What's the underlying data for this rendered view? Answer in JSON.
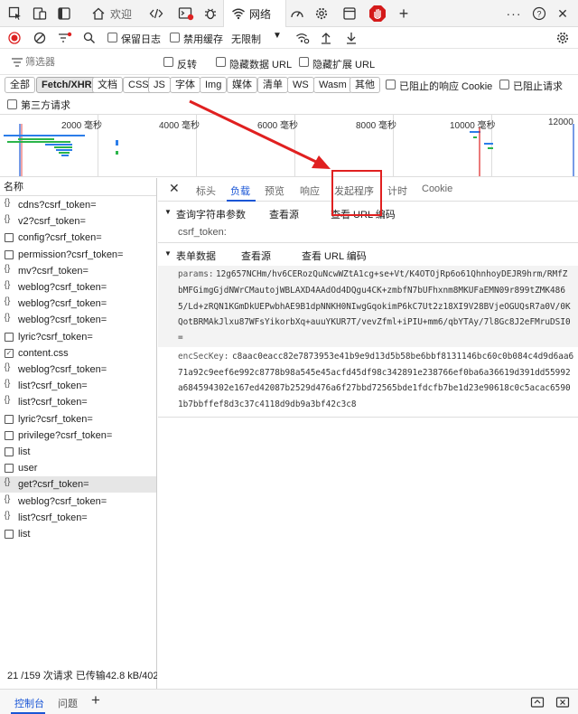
{
  "tabs": {
    "welcome": "欢迎",
    "network": "网络"
  },
  "toolbar": {
    "preserve_log": "保留日志",
    "disable_cache": "禁用缓存",
    "throttle": "无限制"
  },
  "filter": {
    "placeholder": "筛选器",
    "invert": "反转",
    "hide_data_url": "隐藏数据 URL",
    "hide_ext_url": "隐藏扩展 URL"
  },
  "types": [
    "全部",
    "Fetch/XHR",
    "文档",
    "CSS",
    "JS",
    "字体",
    "Img",
    "媒体",
    "清单",
    "WS",
    "Wasm",
    "其他"
  ],
  "blocked_cookie": "已阻止的响应 Cookie",
  "blocked_requests": "已阻止请求",
  "third_party": "第三方请求",
  "timeline_ticks": [
    "2000 毫秒",
    "4000 毫秒",
    "6000 毫秒",
    "8000 毫秒",
    "10000 毫秒",
    "12000"
  ],
  "list_header": "名称",
  "requests": [
    "cdns?csrf_token=",
    "v2?csrf_token=",
    "config?csrf_token=",
    "permission?csrf_token=",
    "mv?csrf_token=",
    "weblog?csrf_token=",
    "weblog?csrf_token=",
    "weblog?csrf_token=",
    "lyric?csrf_token=",
    "content.css",
    "weblog?csrf_token=",
    "list?csrf_token=",
    "list?csrf_token=",
    "lyric?csrf_token=",
    "privilege?csrf_token=",
    "list",
    "user",
    "get?csrf_token=",
    "weblog?csrf_token=",
    "list?csrf_token=",
    "list"
  ],
  "status": "21 /159 次请求  已传输42.8 kB/402",
  "detail_tabs": [
    "标头",
    "负载",
    "预览",
    "响应",
    "发起程序",
    "计时",
    "Cookie"
  ],
  "query": {
    "title": "查询字符串参数",
    "view_source": "查看源",
    "view_url": "查看 URL 编码",
    "param": "csrf_token:"
  },
  "form": {
    "title": "表单数据",
    "view_source": "查看源",
    "view_url": "查看 URL 编码",
    "params_key": "params:",
    "params_lines": [
      "12g657NCHm/hv6CERozQuNcwWZtA1cg+se+Vt/K4OTOjRp6o61QhnhoyDEJR9hrm/RMfZ",
      "bMFGimgGjdNWrCMautojWBLAXD4AAdOd4DQgu4CK+zmbfN7bUFhxnm8MKUFaEMN09r899tZMK486",
      "5/Ld+zRQN1KGmDkUEPwbhAE9B1dpNNKH0NIwgGqokimP6kC7Ut2z18XI9V28BVjeOGUQsR7a0V/0K",
      "QotBRMAkJlxu87WFsYikorbXq+auuYKUR7T/vevZfml+iPIU+mm6/qbYTAy/7l8Gc8J2eFMruDSI0",
      "="
    ],
    "enc_key": "encSecKey:",
    "enc_lines": [
      "c8aac0eacc82e7873953e41b9e9d13d5b58be6bbf8131146bc60c0b084c4d9d6aa6",
      "71a92c9eef6e992c8778b98a545e45acfd45df98c342891e238766ef0ba6a36619d391dd55992",
      "a684594302e167ed42087b2529d476a6f27bbd72565bde1fdcfb7be1d23e90618c0c5acac6590",
      "1b7bbffef8d3c37c4118d9db9a3bf42c3c8"
    ]
  },
  "bottom": {
    "console": "控制台",
    "issues": "问题"
  },
  "colors": {
    "accent": "#1a56d6",
    "annotation": "#e02020"
  }
}
